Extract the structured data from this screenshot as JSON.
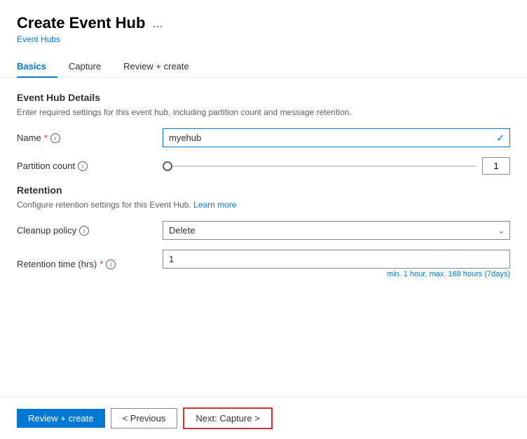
{
  "header": {
    "title": "Create Event Hub",
    "ellipsis": "...",
    "breadcrumb": "Event Hubs"
  },
  "tabs": [
    {
      "id": "basics",
      "label": "Basics",
      "active": true
    },
    {
      "id": "capture",
      "label": "Capture",
      "active": false
    },
    {
      "id": "review",
      "label": "Review + create",
      "active": false
    }
  ],
  "basics": {
    "section_title": "Event Hub Details",
    "section_description": "Enter required settings for this event hub, including partition count and message retention.",
    "name_label": "Name",
    "name_value": "myehub",
    "name_placeholder": "myehub",
    "partition_label": "Partition count",
    "partition_value": "1",
    "retention_section_title": "Retention",
    "retention_description_text": "Configure retention settings for this Event Hub.",
    "retention_learn_more": "Learn more",
    "cleanup_label": "Cleanup policy",
    "cleanup_value": "Delete",
    "retention_time_label": "Retention time (hrs)",
    "retention_time_value": "1",
    "retention_hint": "min. 1 hour, max. 168 hours (7days)"
  },
  "footer": {
    "review_create_label": "Review + create",
    "previous_label": "< Previous",
    "next_label": "Next: Capture >"
  }
}
